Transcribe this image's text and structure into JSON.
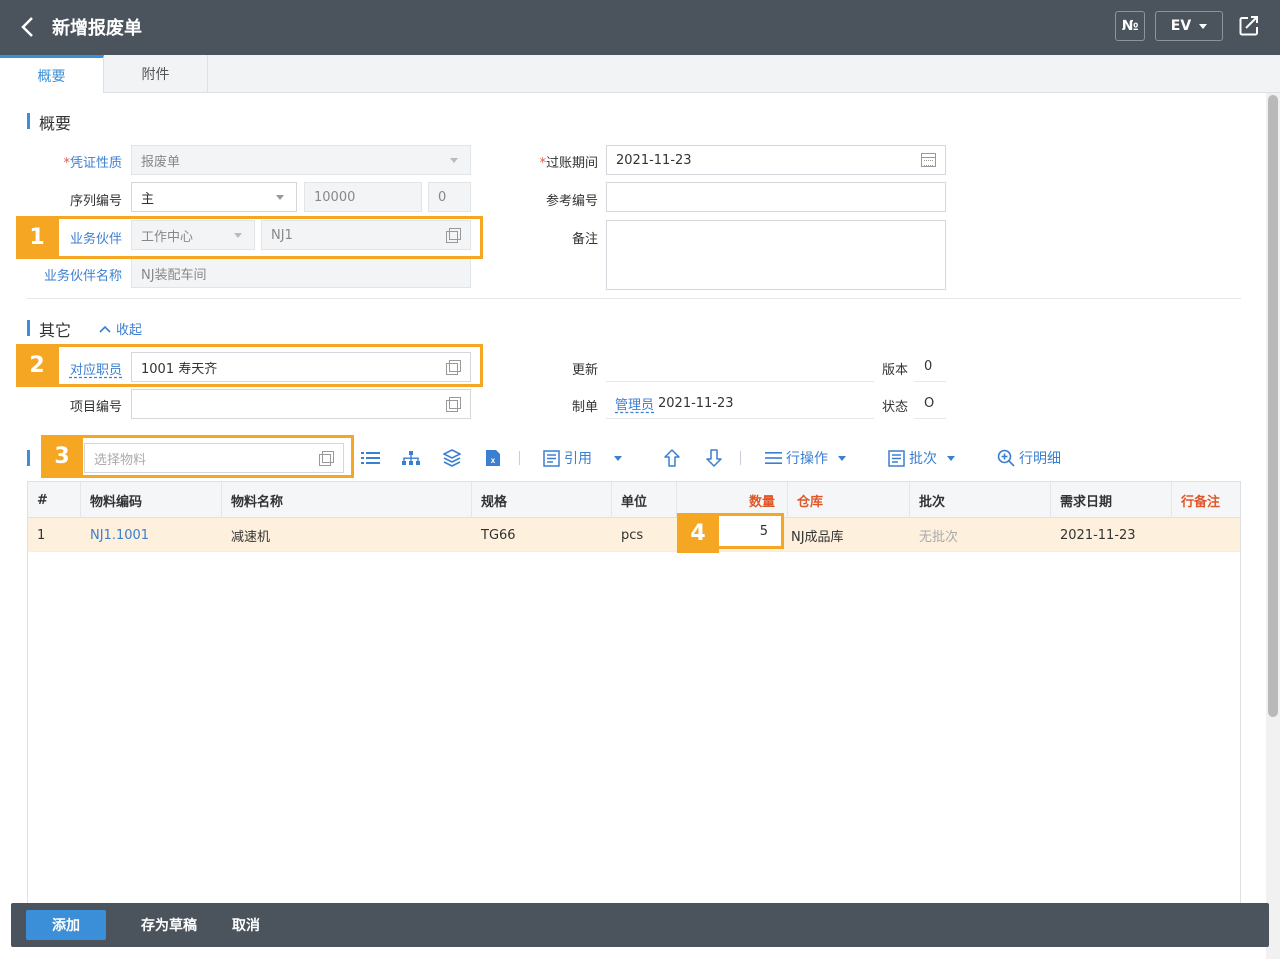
{
  "header": {
    "title": "新增报废单",
    "btn_no": "№",
    "btn_ev": "EV"
  },
  "tabs": [
    {
      "label": "概要"
    },
    {
      "label": "附件"
    }
  ],
  "summary": {
    "section_title": "概要",
    "voucher_type": {
      "label": "凭证性质",
      "value": "报废单"
    },
    "posting_date": {
      "label": "过账期间",
      "value": "2021-11-23"
    },
    "serial": {
      "label": "序列编号",
      "value": "主",
      "number": "10000",
      "suffix": "0"
    },
    "reference": {
      "label": "参考编号",
      "value": ""
    },
    "partner": {
      "label": "业务伙伴",
      "type": "工作中心",
      "code": "NJ1"
    },
    "remark": {
      "label": "备注",
      "value": ""
    },
    "partner_name": {
      "label": "业务伙伴名称",
      "value": "NJ装配车间"
    }
  },
  "other": {
    "section_title": "其它",
    "collapse_label": "收起",
    "employee": {
      "label": "对应职员",
      "value": "1001 寿天齐"
    },
    "project": {
      "label": "项目编号",
      "value": ""
    },
    "update": {
      "label": "更新",
      "value": ""
    },
    "version": {
      "label": "版本",
      "value": "0"
    },
    "creator": {
      "label": "制单",
      "name": "管理员",
      "date": "2021-11-23"
    },
    "status": {
      "label": "状态",
      "value": "O"
    }
  },
  "toolbar": {
    "select_material_placeholder": "选择物料",
    "reference": "引用",
    "row_ops": "行操作",
    "batch": "批次",
    "row_detail": "行明细"
  },
  "table": {
    "headers": [
      "#",
      "物料编码",
      "物料名称",
      "规格",
      "单位",
      "数量",
      "仓库",
      "批次",
      "需求日期",
      "行备注"
    ],
    "rows": [
      {
        "no": "1",
        "code": "NJ1.1001",
        "name": "减速机",
        "spec": "TG66",
        "unit": "pcs",
        "qty": "5",
        "warehouse": "NJ成品库",
        "batch": "无批次",
        "date": "2021-11-23",
        "note": ""
      }
    ]
  },
  "footer": {
    "add": "添加",
    "draft": "存为草稿",
    "cancel": "取消"
  },
  "badges": [
    "1",
    "2",
    "3",
    "4"
  ],
  "colors": {
    "header_bg": "#4b535c",
    "accent": "#3b8ed8",
    "highlight": "#f5a623",
    "row_highlight": "#fdf0dd"
  }
}
